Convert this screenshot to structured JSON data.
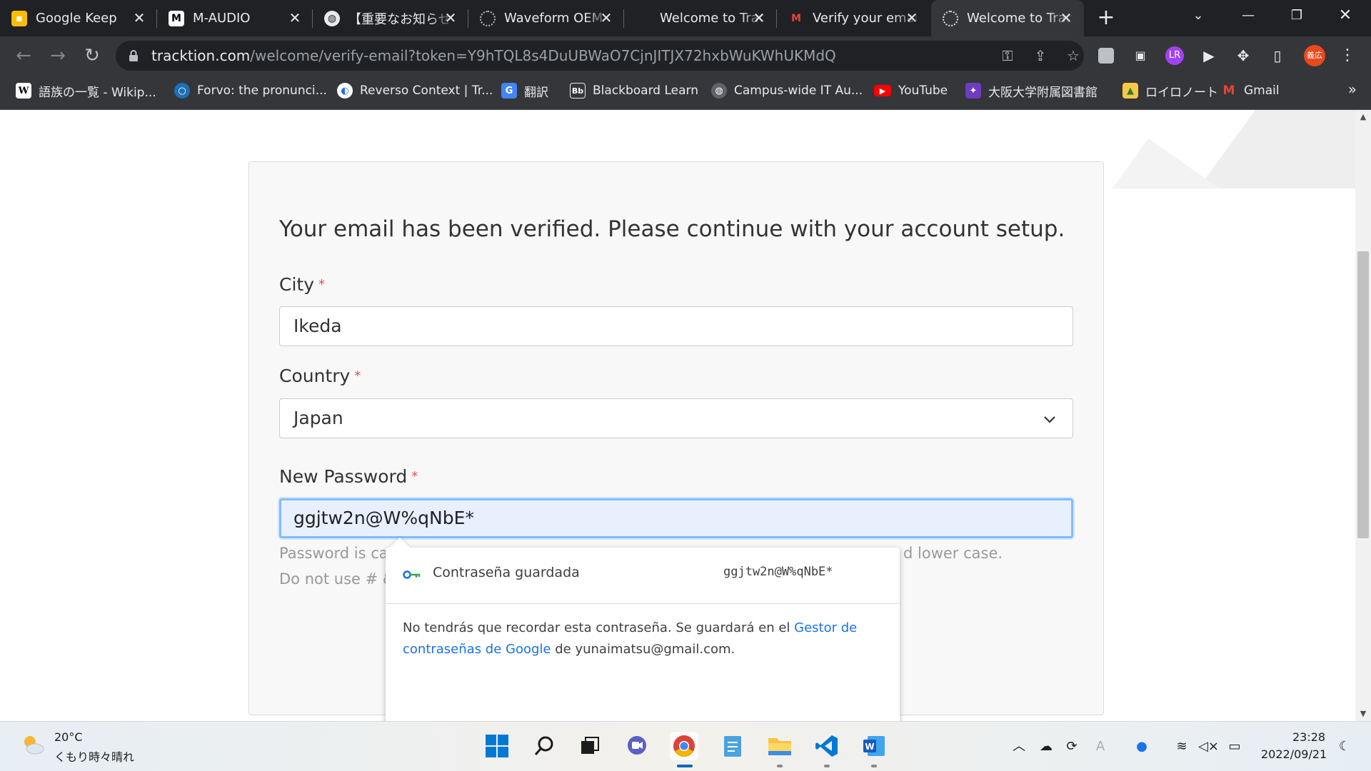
{
  "browser": {
    "tabs": [
      {
        "title": "Google Keep",
        "icon": "google-keep-icon",
        "color": "#fbbc04",
        "glyph": "💡"
      },
      {
        "title": "M-AUDIO",
        "icon": "m-audio-icon",
        "color": "#000000",
        "glyph": "M"
      },
      {
        "title": "【重要なお知らせ",
        "icon": "globe-icon",
        "color": "#202124",
        "glyph": "🌐"
      },
      {
        "title": "Waveform OEM",
        "icon": "tracktion-icon",
        "color": "#202124",
        "glyph": "◌"
      },
      {
        "title": "Welcome to Tracktion",
        "icon": "",
        "color": "#202124",
        "glyph": ""
      },
      {
        "title": "Verify your email",
        "icon": "gmail-icon",
        "color": "#202124",
        "glyph": "M"
      },
      {
        "title": "Welcome to Tracktion",
        "icon": "tracktion-icon",
        "color": "#35363a",
        "glyph": "◌",
        "active": true
      }
    ],
    "new_tab": "+",
    "url_host": "tracktion.com",
    "url_path": "/welcome/verify-email?token=Y9hTQL8s4DuUBWaO7CjnJITJX72hxbWuKWhUKMdQ",
    "profile_initials": "義広"
  },
  "bookmarks": [
    {
      "label": "語族の一覧 - Wikip...",
      "icon": "wikipedia-icon",
      "color": "#ffffff",
      "text_color": "#000000",
      "glyph": "W"
    },
    {
      "label": "Forvo: the pronunci...",
      "icon": "forvo-icon",
      "color": "#1d6fb8",
      "text_color": "#ffffff",
      "glyph": "○"
    },
    {
      "label": "Reverso Context | Tr...",
      "icon": "reverso-icon",
      "color": "#ffffff",
      "text_color": "#1a73e8",
      "glyph": "◐"
    },
    {
      "label": "翻訳",
      "icon": "google-translate-icon",
      "color": "#4285f4",
      "text_color": "#ffffff",
      "glyph": "G"
    },
    {
      "label": "Blackboard Learn",
      "icon": "blackboard-icon",
      "color": "#35363a",
      "text_color": "#ffffff",
      "glyph": "Bb"
    },
    {
      "label": "Campus-wide IT Au...",
      "icon": "globe-icon",
      "color": "#5f6368",
      "text_color": "#ffffff",
      "glyph": "◍"
    },
    {
      "label": "YouTube",
      "icon": "youtube-icon",
      "color": "#ff0000",
      "text_color": "#ffffff",
      "glyph": "▶"
    },
    {
      "label": "大阪大学附属図書館",
      "icon": "osaka-univ-icon",
      "color": "#6c3cc1",
      "text_color": "#ffffff",
      "glyph": "✦"
    },
    {
      "label": "ロイロノート",
      "icon": "loilo-icon",
      "color": "#f7c948",
      "text_color": "#2e7d32",
      "glyph": "▲"
    },
    {
      "label": "Gmail",
      "icon": "gmail-icon",
      "color": "#35363a",
      "text_color": "#ea4335",
      "glyph": "M"
    }
  ],
  "bookmarks_more": "»",
  "form": {
    "heading": "Your email has been verified. Please continue with your account setup.",
    "city_label": "City",
    "city_value": "Ikeda",
    "country_label": "Country",
    "country_value": "Japan",
    "password_label": "New Password",
    "password_value": "ggjtw2n@W%qNbE*",
    "required_mark": "*",
    "help_line1_left": "Password is cas",
    "help_line1_right": "d lower case.",
    "help_line2_left": "Do not use # &"
  },
  "password_popup": {
    "saved_label": "Contraseña guardada",
    "saved_password": "ggjtw2n@W%qNbE*",
    "note_prefix": "No tendrás que recordar esta contraseña. Se guardará en el ",
    "note_link": "Gestor de contraseñas de Google",
    "note_suffix": " de yunaimatsu@gmail.com."
  },
  "taskbar": {
    "temperature": "20°C",
    "weather": "くもり時々晴れ",
    "time": "23:28",
    "date": "2022/09/21"
  },
  "colors": {
    "accent_link": "#1a73e8",
    "required": "#d9534f",
    "focus_border": "#80bdff",
    "autofill_bg": "#e8f0fe"
  }
}
